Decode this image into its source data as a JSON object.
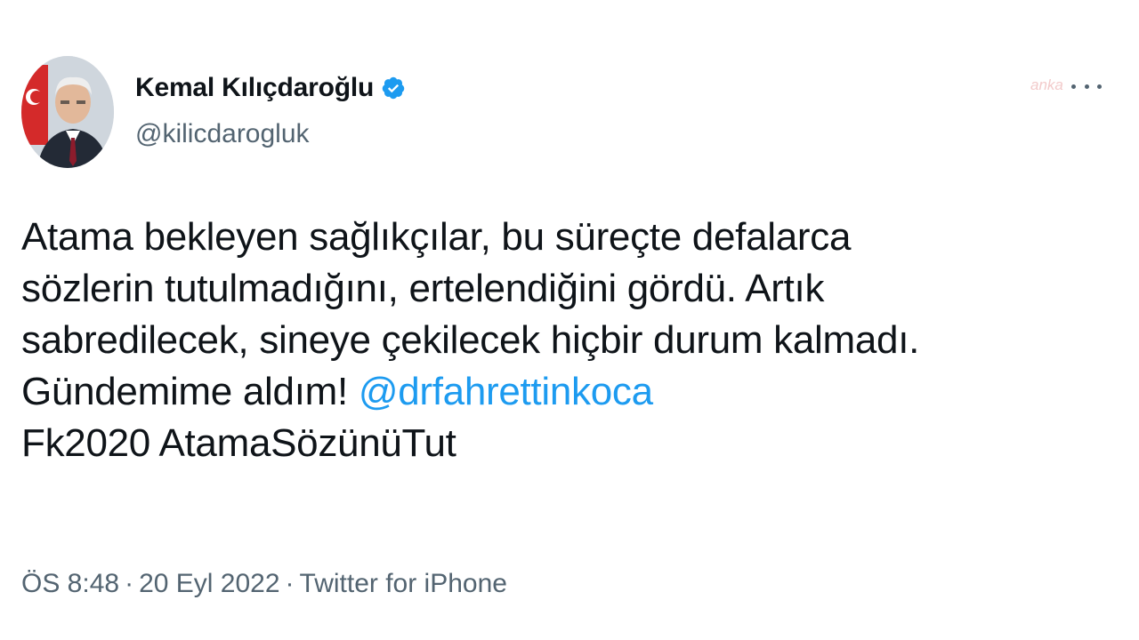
{
  "author": {
    "name": "Kemal Kılıçdaroğlu",
    "handle": "@kilicdarogluk",
    "verified_icon": "verified-badge-icon",
    "avatar_icon": "profile-photo"
  },
  "watermark": "anka",
  "tweet": {
    "line1": "Atama bekleyen sağlıkçılar, bu süreçte defalarca",
    "line2": "sözlerin tutulmadığını, ertelendiğini gördü. Artık",
    "line3": "sabredilecek, sineye çekilecek hiçbir durum kalmadı.",
    "line4_text": "Gündemime aldım! ",
    "mention": "@drfahrettinkoca",
    "line5": "Fk2020 AtamaSözünüTut"
  },
  "meta": {
    "time": "ÖS 8:48",
    "separator": "·",
    "date": "20 Eyl 2022",
    "source": "Twitter for iPhone"
  },
  "colors": {
    "accent": "#1d9bf0",
    "text": "#0f1419",
    "secondary": "#536471"
  }
}
